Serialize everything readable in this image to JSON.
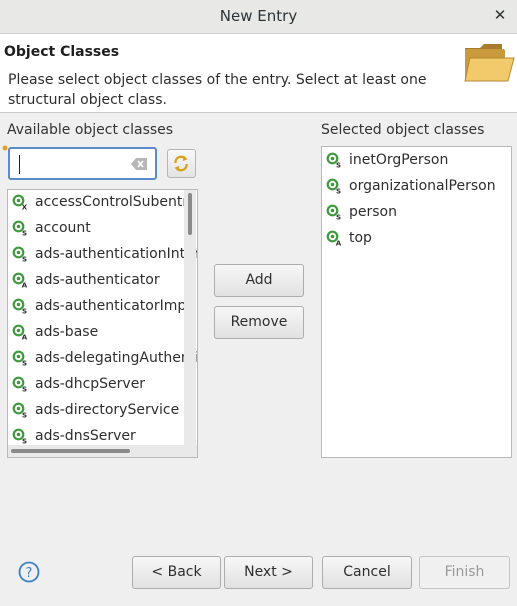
{
  "window": {
    "title": "New Entry",
    "close_glyph": "✕"
  },
  "header": {
    "title": "Object Classes",
    "description": "Please select object classes of the entry. Select at least one structural object class.",
    "icon": "folder-icon"
  },
  "available": {
    "label": "Available object classes",
    "filter_value": "",
    "items": [
      {
        "label": "accessControlSubentry",
        "kind": "X"
      },
      {
        "label": "account",
        "kind": "S"
      },
      {
        "label": "ads-authenticationInterceptor",
        "kind": "S"
      },
      {
        "label": "ads-authenticator",
        "kind": "A"
      },
      {
        "label": "ads-authenticatorImpl",
        "kind": "S"
      },
      {
        "label": "ads-base",
        "kind": "A"
      },
      {
        "label": "ads-delegatingAuthenticator",
        "kind": "S"
      },
      {
        "label": "ads-dhcpServer",
        "kind": "S"
      },
      {
        "label": "ads-directoryService",
        "kind": "S"
      },
      {
        "label": "ads-dnsServer",
        "kind": "S"
      }
    ]
  },
  "selected": {
    "label": "Selected object classes",
    "items": [
      {
        "label": "inetOrgPerson",
        "kind": "S"
      },
      {
        "label": "organizationalPerson",
        "kind": "S"
      },
      {
        "label": "person",
        "kind": "S"
      },
      {
        "label": "top",
        "kind": "A"
      }
    ]
  },
  "actions": {
    "add": "Add",
    "remove": "Remove"
  },
  "footer": {
    "back": "< Back",
    "next": "Next >",
    "cancel": "Cancel",
    "finish": "Finish",
    "help_glyph": "?"
  },
  "colors": {
    "accent": "#5b8cc9",
    "icon_green": "#3d9a3d"
  }
}
